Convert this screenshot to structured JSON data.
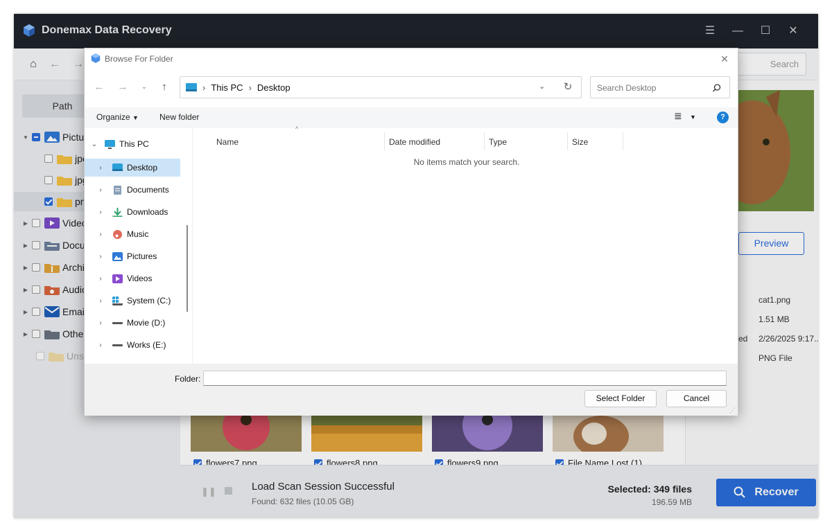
{
  "app": {
    "title": "Donemax Data Recovery",
    "accent": "#2a6ddb",
    "search_placeholder": "Search"
  },
  "sidebar": {
    "tab_label": "Path",
    "items": [
      {
        "label": "Pictures",
        "icon": "pictures-icon",
        "state": "partial",
        "expanded": true
      },
      {
        "label": "jpeg",
        "icon": "folder-icon",
        "state": "unchecked",
        "child": true
      },
      {
        "label": "jpg",
        "icon": "folder-icon",
        "state": "unchecked",
        "child": true
      },
      {
        "label": "png",
        "icon": "folder-icon",
        "state": "checked",
        "child": true,
        "selected": true
      },
      {
        "label": "Video",
        "icon": "video-icon",
        "state": "unchecked"
      },
      {
        "label": "Document",
        "icon": "document-icon",
        "state": "unchecked"
      },
      {
        "label": "Archive",
        "icon": "archive-icon",
        "state": "unchecked"
      },
      {
        "label": "Audio",
        "icon": "audio-icon",
        "state": "unchecked"
      },
      {
        "label": "Email",
        "icon": "email-icon",
        "state": "unchecked"
      },
      {
        "label": "Other",
        "icon": "other-folder-icon",
        "state": "unchecked"
      },
      {
        "label": "Unsaved",
        "icon": "unsaved-folder-icon",
        "state": "disabled"
      }
    ]
  },
  "thumbnails": [
    {
      "name": "flowers7.png",
      "checked": true
    },
    {
      "name": "flowers8.png",
      "checked": true
    },
    {
      "name": "flowers9.png",
      "checked": true
    },
    {
      "name": "File Name Lost (1)....",
      "checked": true
    }
  ],
  "right_panel": {
    "preview_label": "Preview",
    "file_name": "cat1.png",
    "file_size": "1.51 MB",
    "date_label": "ed",
    "date": "2/26/2025 9:17...",
    "file_type": "PNG File"
  },
  "bottom": {
    "status": "Load Scan Session Successful",
    "found": "Found: 632 files (10.05 GB)",
    "selected": "Selected: 349 files",
    "selected_size": "196.59 MB",
    "recover_label": "Recover"
  },
  "dialog": {
    "title": "Browse For Folder",
    "breadcrumb": [
      "This PC",
      "Desktop"
    ],
    "search_placeholder": "Search Desktop",
    "organize_label": "Organize",
    "new_folder_label": "New folder",
    "nav_items": [
      {
        "label": "This PC",
        "expanded": true,
        "icon": "this-pc-icon"
      },
      {
        "label": "Desktop",
        "selected": true,
        "icon": "desktop-icon"
      },
      {
        "label": "Documents",
        "icon": "documents-icon"
      },
      {
        "label": "Downloads",
        "icon": "downloads-icon"
      },
      {
        "label": "Music",
        "icon": "music-icon"
      },
      {
        "label": "Pictures",
        "icon": "pictures-icon"
      },
      {
        "label": "Videos",
        "icon": "videos-icon"
      },
      {
        "label": "System (C:)",
        "icon": "system-drive-icon"
      },
      {
        "label": "Movie (D:)",
        "icon": "drive-icon"
      },
      {
        "label": "Works (E:)",
        "icon": "drive-icon"
      }
    ],
    "columns": [
      "Name",
      "Date modified",
      "Type",
      "Size"
    ],
    "empty_message": "No items match your search.",
    "folder_label": "Folder:",
    "folder_value": "",
    "select_folder_label": "Select Folder",
    "cancel_label": "Cancel"
  }
}
